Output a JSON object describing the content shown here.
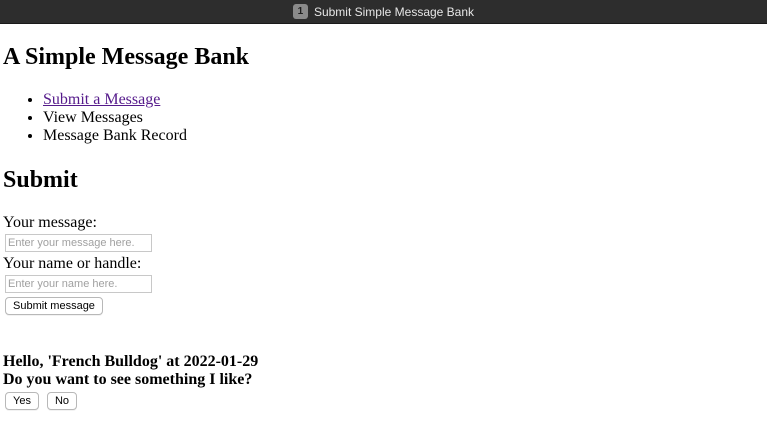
{
  "window": {
    "tab_index": "1",
    "title": "Submit Simple Message Bank"
  },
  "page": {
    "heading": "A Simple Message Bank",
    "nav": [
      {
        "label": "Submit a Message",
        "link": true
      },
      {
        "label": "View Messages",
        "link": false
      },
      {
        "label": "Message Bank Record",
        "link": false
      }
    ],
    "section_heading": "Submit"
  },
  "form": {
    "message_label": "Your message:",
    "message_placeholder": "Enter your message here.",
    "message_value": "",
    "name_label": "Your name or handle:",
    "name_placeholder": "Enter your name here.",
    "name_value": "",
    "submit_label": "Submit message"
  },
  "prompt": {
    "greeting": "Hello, 'French Bulldog' at 2022-01-29",
    "question": "Do you want to see something I like?",
    "yes_label": "Yes",
    "no_label": "No"
  }
}
